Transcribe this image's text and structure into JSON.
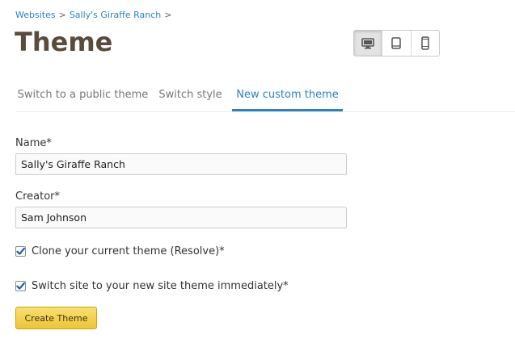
{
  "breadcrumb": {
    "items": [
      {
        "label": "Websites"
      },
      {
        "label": "Sally's Giraffe Ranch"
      }
    ],
    "separator": ">"
  },
  "page": {
    "title": "Theme"
  },
  "device_toggle": {
    "options": [
      {
        "icon": "desktop-icon",
        "active": true
      },
      {
        "icon": "tablet-icon",
        "active": false
      },
      {
        "icon": "phone-icon",
        "active": false
      }
    ]
  },
  "tabs": [
    {
      "label": "Switch to a public theme",
      "active": false
    },
    {
      "label": "Switch style",
      "active": false
    },
    {
      "label": "New custom theme",
      "active": true
    }
  ],
  "form": {
    "name_label": "Name*",
    "name_value": "Sally's Giraffe Ranch",
    "creator_label": "Creator*",
    "creator_value": "Sam Johnson",
    "clone_label": "Clone your current theme (Resolve)*",
    "clone_checked": true,
    "switch_label": "Switch site to your new site theme immediately*",
    "switch_checked": true,
    "submit_label": "Create Theme"
  },
  "colors": {
    "link": "#2a82c4",
    "title": "#594c3d",
    "tab_active": "#2a82c4",
    "tab_inactive": "#777777",
    "button": "#f2d048",
    "checkbox_check": "#1f5fa8"
  }
}
